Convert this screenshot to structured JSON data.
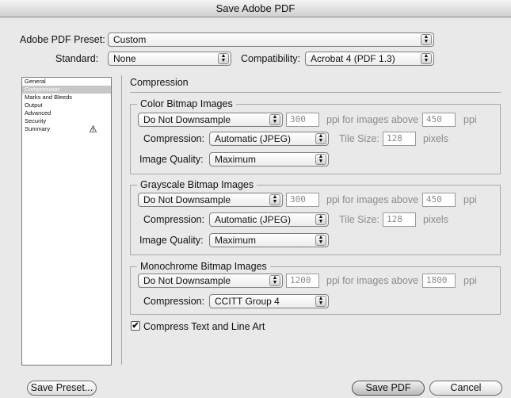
{
  "window": {
    "title": "Save Adobe PDF"
  },
  "preset": {
    "label": "Adobe PDF Preset:",
    "value": "Custom"
  },
  "standard": {
    "label": "Standard:",
    "value": "None"
  },
  "compatibility": {
    "label": "Compatibility:",
    "value": "Acrobat 4 (PDF 1.3)"
  },
  "sidebar": {
    "items": [
      {
        "label": "General"
      },
      {
        "label": "Compression"
      },
      {
        "label": "Marks and Bleeds"
      },
      {
        "label": "Output"
      },
      {
        "label": "Advanced"
      },
      {
        "label": "Security"
      },
      {
        "label": "Summary"
      }
    ]
  },
  "section_title": "Compression",
  "color_bitmap": {
    "legend": "Color Bitmap Images",
    "downsample": "Do Not Downsample",
    "ppi": "300",
    "ppi_above_label": "ppi for images above",
    "ppi_above": "450",
    "ppi_unit": "ppi",
    "compression_label": "Compression:",
    "compression": "Automatic (JPEG)",
    "tile_label": "Tile Size:",
    "tile": "128",
    "tile_unit": "pixels",
    "quality_label": "Image Quality:",
    "quality": "Maximum"
  },
  "grayscale_bitmap": {
    "legend": "Grayscale Bitmap Images",
    "downsample": "Do Not Downsample",
    "ppi": "300",
    "ppi_above_label": "ppi for images above",
    "ppi_above": "450",
    "ppi_unit": "ppi",
    "compression_label": "Compression:",
    "compression": "Automatic (JPEG)",
    "tile_label": "Tile Size:",
    "tile": "128",
    "tile_unit": "pixels",
    "quality_label": "Image Quality:",
    "quality": "Maximum"
  },
  "monochrome_bitmap": {
    "legend": "Monochrome Bitmap Images",
    "downsample": "Do Not Downsample",
    "ppi": "1200",
    "ppi_above_label": "ppi for images above",
    "ppi_above": "1800",
    "ppi_unit": "ppi",
    "compression_label": "Compression:",
    "compression": "CCITT Group 4"
  },
  "compress_text": {
    "label": "Compress Text and Line Art",
    "checked": true,
    "mark": "✔"
  },
  "buttons": {
    "save_preset": "Save Preset...",
    "save_pdf": "Save PDF",
    "cancel": "Cancel"
  },
  "popup_arrows": {
    "up": "▲",
    "down": "▼"
  }
}
